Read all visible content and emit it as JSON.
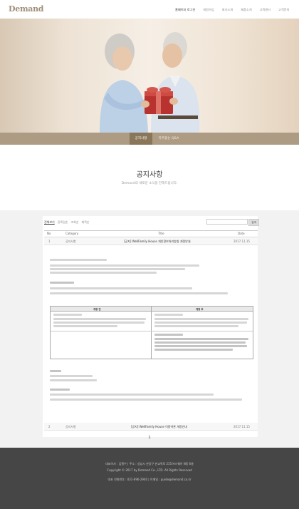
{
  "header": {
    "logo": "Demand",
    "nav": [
      "홈페이지 로그인",
      "회원가입",
      "회사소개",
      "제품소개",
      "고객센터",
      "고객문의"
    ]
  },
  "hero": {
    "image": "elderly-couple-gift-photo"
  },
  "tabs": [
    {
      "label": "공지사항",
      "active": true
    },
    {
      "label": "자주묻는 Q&A",
      "active": false
    }
  ],
  "page": {
    "title": "공지사항",
    "subtitle": "Demand의 새로운 소식을 전해드립니다."
  },
  "board": {
    "sort_options": [
      "전체보기",
      "등록일순",
      "조회순",
      "제목순"
    ],
    "search_button": "검색",
    "columns": [
      "No",
      "Category",
      "Title",
      "Date"
    ],
    "rows": [
      {
        "no": "1",
        "category": "공지사항",
        "title": "[공지] WellFamily House 개인정보처리방침 개정안내",
        "date": "2017.11.15"
      },
      {
        "no": "2",
        "category": "공지사항",
        "title": "[공지] WellFamily House 이용약관 개정안내",
        "date": "2017.11.15"
      }
    ],
    "content_table_headers": [
      "개정 전",
      "개정 후"
    ],
    "current_page": "1"
  },
  "footer": {
    "lines": [
      "대표이사 : 김철수 | 주소 : 성남시 분당구 판교역로 235 H스퀘어 N동 6층",
      "Copyright © 2017 by Demand Co., LTD. All Rights Reserved",
      "대표 전화번호 : 031-696-2940 | 이메일 : guide@demand.co.kr"
    ]
  },
  "colors": {
    "brand": "#a08f7a",
    "tab_bar": "#ad9c83",
    "tab_active": "#8a7659",
    "footer_bg": "#464646"
  }
}
